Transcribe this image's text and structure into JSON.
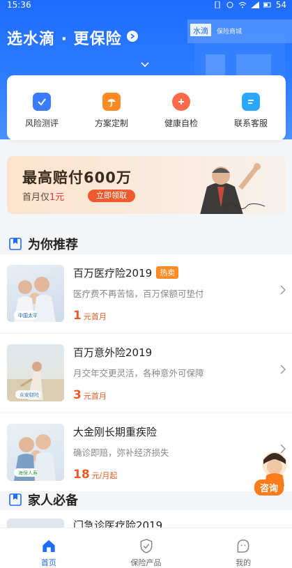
{
  "status_bar": {
    "time": "15:36",
    "battery": "54"
  },
  "header": {
    "title": "选水滴 · 更保险",
    "deco_sign": "水滴",
    "deco_sign2": "保险商城"
  },
  "quick_entries": [
    {
      "label": "风险测评",
      "icon": "shield-check-icon",
      "color": "#3a7bff"
    },
    {
      "label": "方案定制",
      "icon": "umbrella-doc-icon",
      "color": "#ff8a22"
    },
    {
      "label": "健康自检",
      "icon": "heart-plus-icon",
      "color": "#ff6b4a"
    },
    {
      "label": "联系客服",
      "icon": "chat-bubble-icon",
      "color": "#2aa8ff"
    }
  ],
  "banner": {
    "title": "最高赔付600万",
    "sub_prefix": "首月仅",
    "sub_price": "1元",
    "button": "立即领取"
  },
  "sections": {
    "recommend": "为你推荐",
    "family": "家人必备"
  },
  "products": [
    {
      "name": "百万医疗险2019",
      "tag": "热卖",
      "desc": "医疗费不再苦恼，百万保额可垫付",
      "price": "1",
      "unit": "元首月",
      "brand": "中国太平"
    },
    {
      "name": "百万意外险2019",
      "tag": "",
      "desc": "月交年交更灵活，各种意外可保障",
      "price": "3",
      "unit": "元首月",
      "brand": "众安财险"
    },
    {
      "name": "大金刚长期重疾险",
      "tag": "",
      "desc": "确诊即赔，弥补经济损失",
      "price": "18",
      "unit": "元/月起",
      "brand": "海保人寿"
    }
  ],
  "family_product": {
    "name": "门急诊医疗险2019"
  },
  "consult": {
    "label": "咨询"
  },
  "tabs": [
    {
      "label": "首页",
      "icon": "home-icon",
      "active": true
    },
    {
      "label": "保险产品",
      "icon": "shield-icon",
      "active": false
    },
    {
      "label": "我的",
      "icon": "profile-face-icon",
      "active": false
    }
  ],
  "colors": {
    "brand_blue": "#1f6bff",
    "price_orange": "#ee5a24",
    "hot_tag": "#ff8a22"
  }
}
